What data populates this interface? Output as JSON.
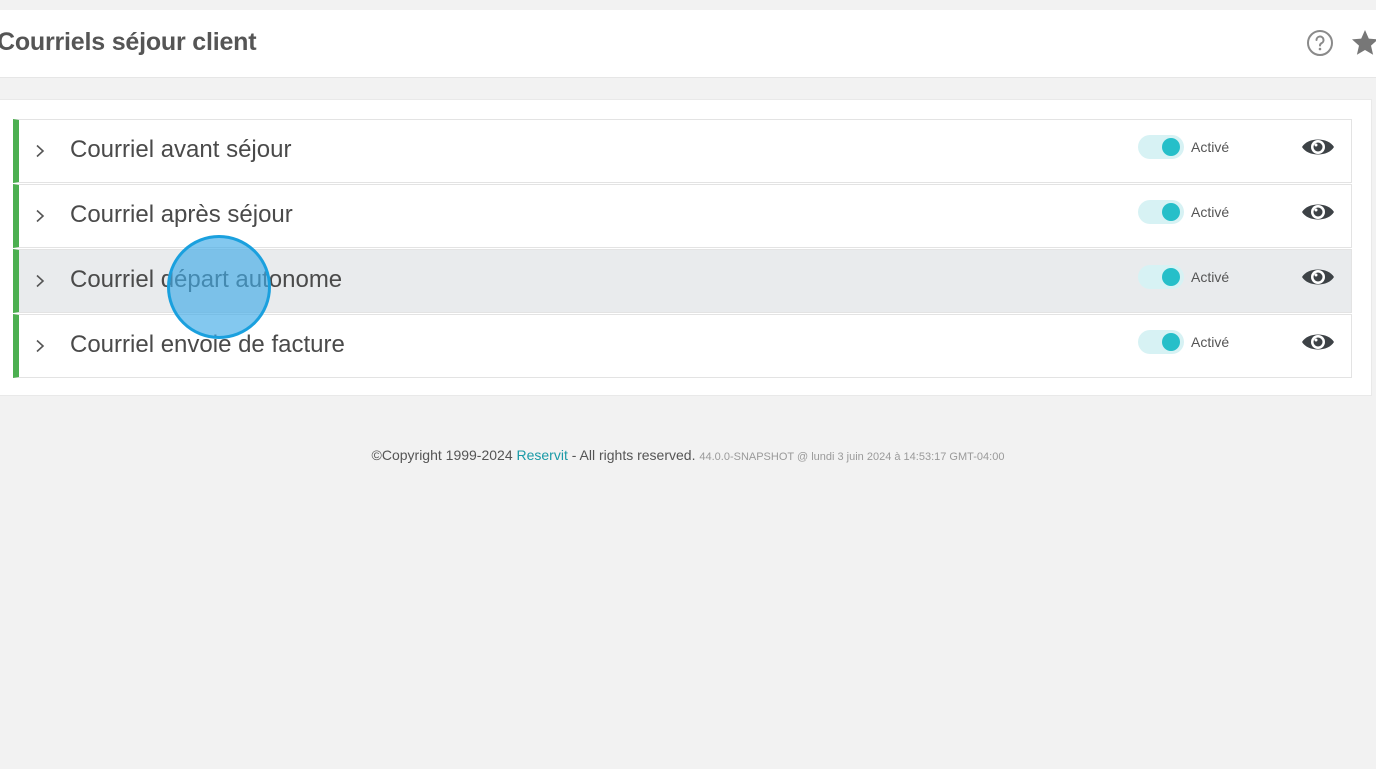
{
  "header": {
    "title": "Courriels séjour client",
    "help_icon": "help-circle-icon",
    "star_icon": "star-icon"
  },
  "rows": [
    {
      "label": "Courriel avant séjour",
      "toggle_label": "Activé",
      "enabled": true
    },
    {
      "label": "Courriel après séjour",
      "toggle_label": "Activé",
      "enabled": true
    },
    {
      "label": "Courriel départ autonome",
      "toggle_label": "Activé",
      "enabled": true
    },
    {
      "label": "Courriel envoie de facture",
      "toggle_label": "Activé",
      "enabled": true
    }
  ],
  "footer": {
    "copyright": "©Copyright 1999-2024",
    "brand": "Reservit",
    "rights": " - All rights reserved.",
    "build": "44.0.0-SNAPSHOT @ lundi 3 juin 2024 à 14:53:17 GMT-04:00"
  },
  "colors": {
    "accent_green": "#4caf50",
    "toggle_on": "#26bfc9",
    "link": "#1a9aa7"
  }
}
